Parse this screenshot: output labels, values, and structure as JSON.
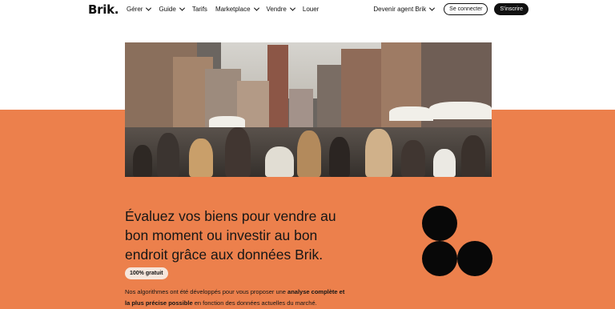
{
  "brand": {
    "logo": "Brik."
  },
  "nav": {
    "items": [
      {
        "label": "Gérer",
        "has_dropdown": true
      },
      {
        "label": "Guide",
        "has_dropdown": true
      },
      {
        "label": "Tarifs",
        "has_dropdown": false
      },
      {
        "label": "Marketplace",
        "has_dropdown": true
      },
      {
        "label": "Vendre",
        "has_dropdown": true
      },
      {
        "label": "Louer",
        "has_dropdown": false
      }
    ],
    "agent_label": "Devenir agent Brik",
    "login_label": "Se connecter",
    "signup_label": "S'inscrire"
  },
  "hero": {
    "headline_line1": "Évaluez vos biens pour vendre au",
    "headline_line2": "bon moment ou investir au bon",
    "headline_line3": "endroit grâce aux données Brik.",
    "badge": "100% gratuit",
    "desc_part1": "Nos algorithmes ont été développés pour vous proposer une ",
    "desc_bold1": "analyse complète et",
    "desc_bold2": "la plus précise possible",
    "desc_part2": " en fonction des données actuelles du marché."
  },
  "colors": {
    "accent_orange": "#ec804c",
    "dark": "#080808"
  }
}
